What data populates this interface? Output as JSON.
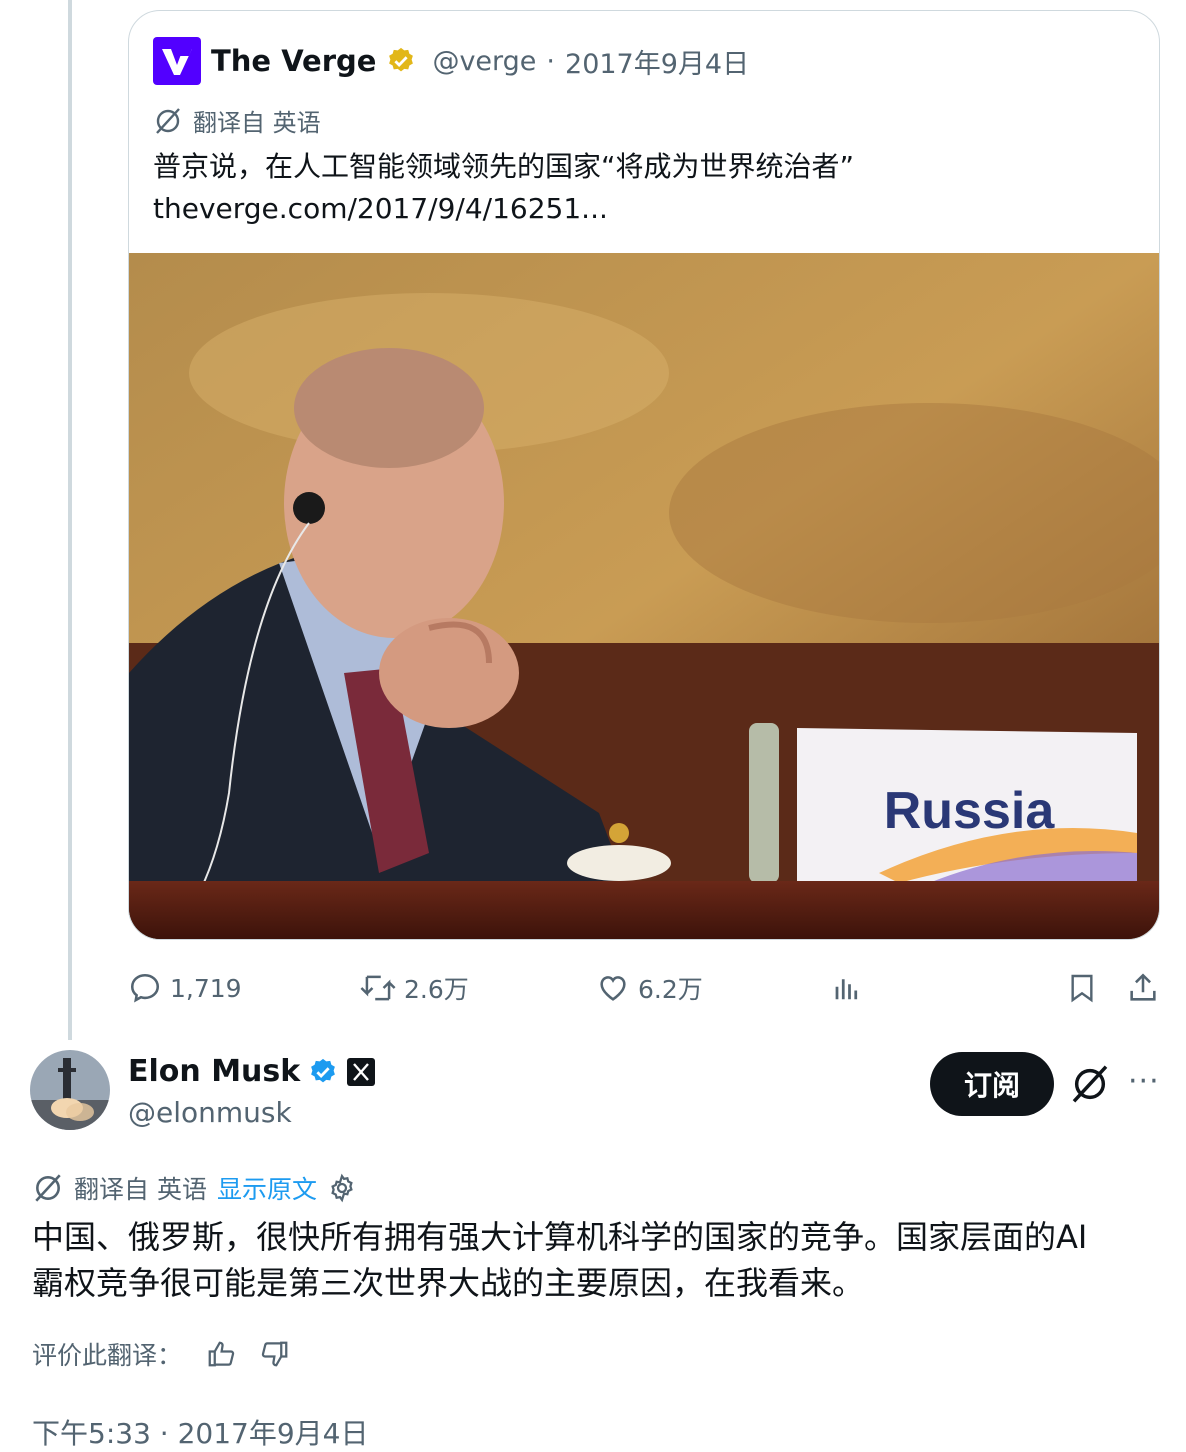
{
  "quoted_tweet": {
    "author_name": "The Verge",
    "handle": "@verge",
    "separator": "·",
    "date": "2017年9月4日",
    "translation_label": "翻译自 英语",
    "text_line1": "普京说，在人工智能领域领先的国家“将成为世界统治者”",
    "text_line2": "theverge.com/2017/9/4/16251...",
    "image_placard": "Russia",
    "accent_color": "#5200ff",
    "verified_badge_color": "#e2b719"
  },
  "actions": {
    "replies": "1,719",
    "reposts": "2.6万",
    "likes": "6.2万",
    "icons": [
      "reply-icon",
      "repost-icon",
      "like-icon",
      "views-icon",
      "bookmark-icon",
      "share-icon"
    ]
  },
  "main_tweet": {
    "author_name": "Elon Musk",
    "handle": "@elonmusk",
    "subscribe_label": "订阅",
    "more_label": "···",
    "translation_label": "翻译自 英语",
    "show_original": "显示原文",
    "text_line1": "中国、俄罗斯，很快所有拥有强大计算机科学的国家的竞争。国家层面的AI",
    "text_line2": "霸权竞争很可能是第三次世界大战的主要原因，在我看来。",
    "rate_label": "评价此翻译：",
    "timestamp": "下午5:33 · 2017年9月4日",
    "verified_badge_color": "#1d9bf0"
  }
}
